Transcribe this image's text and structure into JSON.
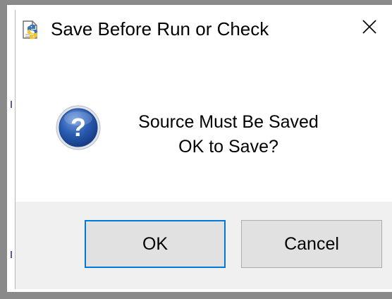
{
  "dialog": {
    "title": "Save Before Run or Check",
    "title_icon": "python-file-icon",
    "close_icon": "close-icon"
  },
  "message": {
    "icon": "question-icon",
    "line1": "Source Must Be Saved",
    "line2": "OK to Save?"
  },
  "buttons": {
    "ok_label": "OK",
    "cancel_label": "Cancel"
  },
  "colors": {
    "footer_bg": "#f0f0f0",
    "button_bg": "#e1e1e1",
    "default_button_border": "#0078d7",
    "question_icon": "#1f4f9e",
    "frame": "#8a8a8a"
  }
}
